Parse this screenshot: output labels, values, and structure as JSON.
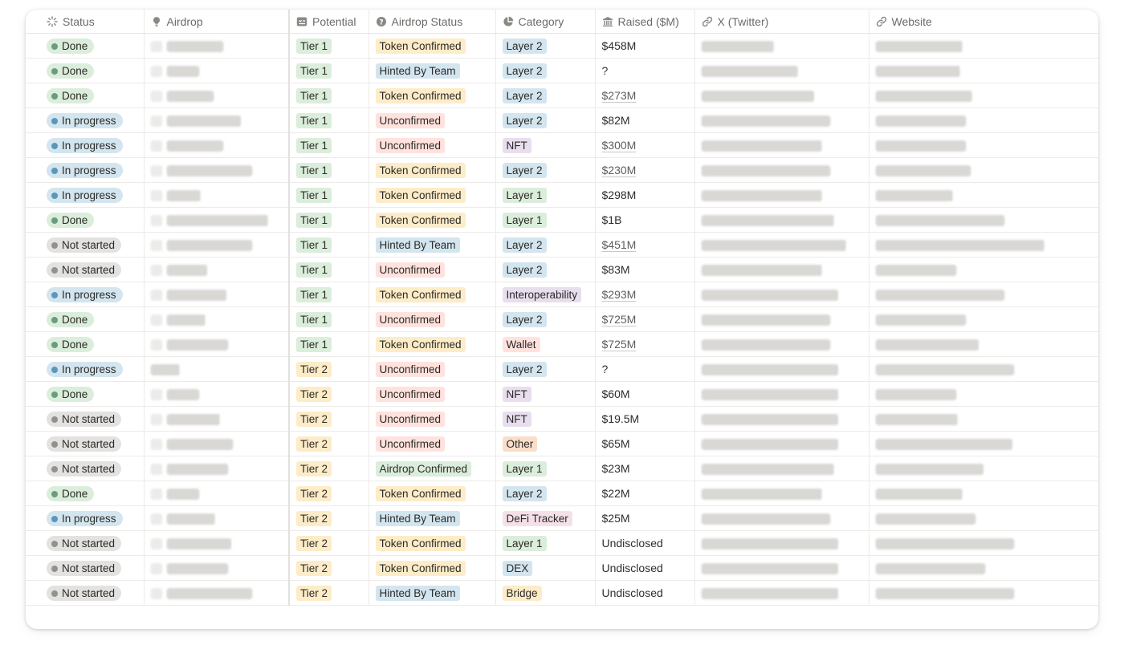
{
  "columns": {
    "status": "Status",
    "airdrop": "Airdrop",
    "potential": "Potential",
    "airdrop_status": "Airdrop Status",
    "category": "Category",
    "raised": "Raised ($M)",
    "x": "X (Twitter)",
    "website": "Website"
  },
  "colors": {
    "status": {
      "Done": {
        "bg": "#dbeddb",
        "dot": "#6c9b7d"
      },
      "In progress": {
        "bg": "#d3e5ef",
        "dot": "#5b97bd"
      },
      "Not started": {
        "bg": "#e3e2e0",
        "dot": "#91918e"
      }
    },
    "tier": {
      "Tier 1": "#dbeddb",
      "Tier 2": "#fdecc8"
    },
    "airdrop_status": {
      "Token Confirmed": "#fdecc8",
      "Hinted By Team": "#d3e5ef",
      "Unconfirmed": "#ffe2dd",
      "Airdrop Confirmed": "#dbeddb"
    },
    "category": {
      "Layer 2": "#d3e5ef",
      "Layer 1": "#dbeddb",
      "NFT": "#e8deee",
      "Interoperability": "#e8deee",
      "Wallet": "#ffe2dd",
      "Other": "#fadec9",
      "DeFi Tracker": "#f5e0e9",
      "DEX": "#d3e5ef",
      "Bridge": "#fdecc8"
    }
  },
  "rows": [
    {
      "status": "Done",
      "potential": "Tier 1",
      "airdrop_status": "Token Confirmed",
      "category": "Layer 2",
      "raised": "$458M"
    },
    {
      "status": "Done",
      "potential": "Tier 1",
      "airdrop_status": "Hinted By Team",
      "category": "Layer 2",
      "raised": "?"
    },
    {
      "status": "Done",
      "potential": "Tier 1",
      "airdrop_status": "Token Confirmed",
      "category": "Layer 2",
      "raised": "$273M"
    },
    {
      "status": "In progress",
      "potential": "Tier 1",
      "airdrop_status": "Unconfirmed",
      "category": "Layer 2",
      "raised": "$82M"
    },
    {
      "status": "In progress",
      "potential": "Tier 1",
      "airdrop_status": "Unconfirmed",
      "category": "NFT",
      "raised": "$300M"
    },
    {
      "status": "In progress",
      "potential": "Tier 1",
      "airdrop_status": "Token Confirmed",
      "category": "Layer 2",
      "raised": "$230M"
    },
    {
      "status": "In progress",
      "potential": "Tier 1",
      "airdrop_status": "Token Confirmed",
      "category": "Layer 1",
      "raised": "$298M"
    },
    {
      "status": "Done",
      "potential": "Tier 1",
      "airdrop_status": "Token Confirmed",
      "category": "Layer 1",
      "raised": "$1B"
    },
    {
      "status": "Not started",
      "potential": "Tier 1",
      "airdrop_status": "Hinted By Team",
      "category": "Layer 2",
      "raised": "$451M"
    },
    {
      "status": "Not started",
      "potential": "Tier 1",
      "airdrop_status": "Unconfirmed",
      "category": "Layer 2",
      "raised": "$83M"
    },
    {
      "status": "In progress",
      "potential": "Tier 1",
      "airdrop_status": "Token Confirmed",
      "category": "Interoperability",
      "raised": "$293M"
    },
    {
      "status": "Done",
      "potential": "Tier 1",
      "airdrop_status": "Unconfirmed",
      "category": "Layer 2",
      "raised": "$725M"
    },
    {
      "status": "Done",
      "potential": "Tier 1",
      "airdrop_status": "Token Confirmed",
      "category": "Wallet",
      "raised": "$725M"
    },
    {
      "status": "In progress",
      "potential": "Tier 2",
      "airdrop_status": "Unconfirmed",
      "category": "Layer 2",
      "raised": "?"
    },
    {
      "status": "Done",
      "potential": "Tier 2",
      "airdrop_status": "Unconfirmed",
      "category": "NFT",
      "raised": "$60M"
    },
    {
      "status": "Not started",
      "potential": "Tier 2",
      "airdrop_status": "Unconfirmed",
      "category": "NFT",
      "raised": "$19.5M"
    },
    {
      "status": "Not started",
      "potential": "Tier 2",
      "airdrop_status": "Unconfirmed",
      "category": "Other",
      "raised": "$65M"
    },
    {
      "status": "Not started",
      "potential": "Tier 2",
      "airdrop_status": "Airdrop Confirmed",
      "category": "Layer 1",
      "raised": "$23M"
    },
    {
      "status": "Done",
      "potential": "Tier 2",
      "airdrop_status": "Token Confirmed",
      "category": "Layer 2",
      "raised": "$22M"
    },
    {
      "status": "In progress",
      "potential": "Tier 2",
      "airdrop_status": "Hinted By Team",
      "category": "DeFi Tracker",
      "raised": "$25M"
    },
    {
      "status": "Not started",
      "potential": "Tier 2",
      "airdrop_status": "Token Confirmed",
      "category": "Layer 1",
      "raised": "Undisclosed"
    },
    {
      "status": "Not started",
      "potential": "Tier 2",
      "airdrop_status": "Token Confirmed",
      "category": "DEX",
      "raised": "Undisclosed"
    },
    {
      "status": "Not started",
      "potential": "Tier 2",
      "airdrop_status": "Hinted By Team",
      "category": "Bridge",
      "raised": "Undisclosed"
    }
  ]
}
